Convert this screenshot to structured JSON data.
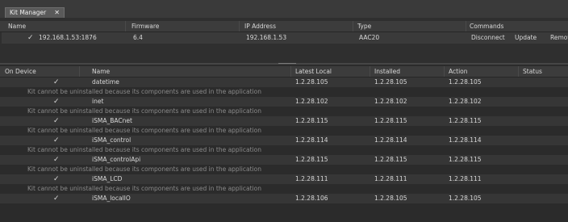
{
  "tab": {
    "title": "Kit Manager",
    "close_icon": "✕"
  },
  "device_table": {
    "headers": [
      "Name",
      "Firmware",
      "IP Address",
      "Type",
      "Commands"
    ],
    "row": {
      "check": "✓",
      "name": "192.168.1.53:1876",
      "firmware": "6.4",
      "ip": "192.168.1.53",
      "type": "AAC20",
      "commands": [
        "Disconnect",
        "Update",
        "Remov"
      ]
    }
  },
  "kit_table": {
    "headers": [
      "On Device",
      "Name",
      "Latest Local",
      "Installed",
      "Action",
      "Status"
    ],
    "note": "Kit cannot be uninstalled because its components are used in the application",
    "rows": [
      {
        "check": "✓",
        "name": "datetime",
        "latest": "1.2.28.105",
        "installed": "1.2.28.105",
        "action": "1.2.28.105",
        "note": true
      },
      {
        "check": "✓",
        "name": "inet",
        "latest": "1.2.28.102",
        "installed": "1.2.28.102",
        "action": "1.2.28.102",
        "note": true
      },
      {
        "check": "✓",
        "name": "iSMA_BACnet",
        "latest": "1.2.28.115",
        "installed": "1.2.28.115",
        "action": "1.2.28.115",
        "note": true
      },
      {
        "check": "✓",
        "name": "iSMA_control",
        "latest": "1.2.28.114",
        "installed": "1.2.28.114",
        "action": "1.2.28.114",
        "note": true
      },
      {
        "check": "✓",
        "name": "iSMA_controlApi",
        "latest": "1.2.28.115",
        "installed": "1.2.28.115",
        "action": "1.2.28.115",
        "note": true
      },
      {
        "check": "✓",
        "name": "iSMA_LCD",
        "latest": "1.2.28.111",
        "installed": "1.2.28.111",
        "action": "1.2.28.111",
        "note": true
      },
      {
        "check": "✓",
        "name": "iSMA_localIO",
        "latest": "1.2.28.106",
        "installed": "1.2.28.105",
        "action": "1.2.28.105",
        "note": false
      }
    ]
  }
}
